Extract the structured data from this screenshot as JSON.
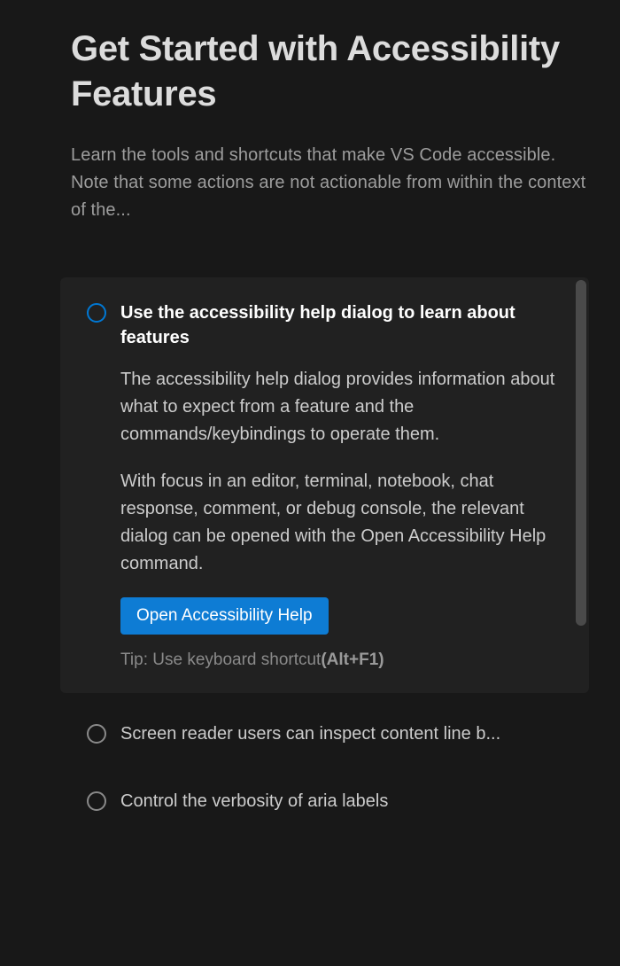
{
  "header": {
    "title": "Get Started with Accessibility Features",
    "subtitle": "Learn the tools and shortcuts that make VS Code accessible. Note that some actions are not actionable from within the context of the..."
  },
  "steps": {
    "active": {
      "title": "Use the accessibility help dialog to learn about features",
      "desc1": "The accessibility help dialog provides information about what to expect from a feature and the commands/keybindings to operate them.",
      "desc2": "With focus in an editor, terminal, notebook, chat response, comment, or debug console, the relevant dialog can be opened with the Open Accessibility Help command.",
      "button_label": "Open Accessibility Help",
      "tip_prefix": "Tip: Use keyboard shortcut",
      "tip_shortcut": "(Alt+F1)"
    },
    "collapsed": [
      {
        "title": "Screen reader users can inspect content line b..."
      },
      {
        "title": "Control the verbosity of aria labels"
      }
    ]
  }
}
